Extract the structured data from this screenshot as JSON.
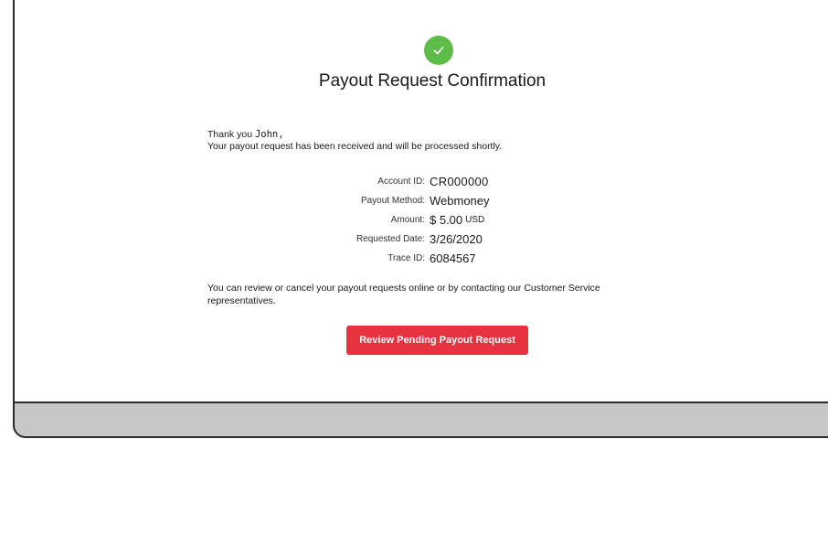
{
  "confirmation": {
    "title": "Payout Request Confirmation",
    "greeting_prefix": "Thank you",
    "user_name": "John,",
    "received_message": "Your payout request has been received and will be processed shortly.",
    "details": [
      {
        "label": "Account ID:",
        "value": "CR000000",
        "unit": ""
      },
      {
        "label": "Payout Method:",
        "value": "Webmoney",
        "unit": ""
      },
      {
        "label": "Amount:",
        "value": "$ 5.00",
        "unit": "USD"
      },
      {
        "label": "Requested Date:",
        "value": "3/26/2020",
        "unit": ""
      },
      {
        "label": "Trace ID:",
        "value": "6084567",
        "unit": ""
      }
    ],
    "info_text": "You can review or cancel your payout requests online or by contacting our Customer Service representatives.",
    "button_label": "Review Pending Payout Request"
  },
  "colors": {
    "accent": "#e8323f",
    "success": "#5dbb4a",
    "device_frame": "#c7c7c8"
  },
  "icons": {
    "success": "check-circle-icon"
  }
}
